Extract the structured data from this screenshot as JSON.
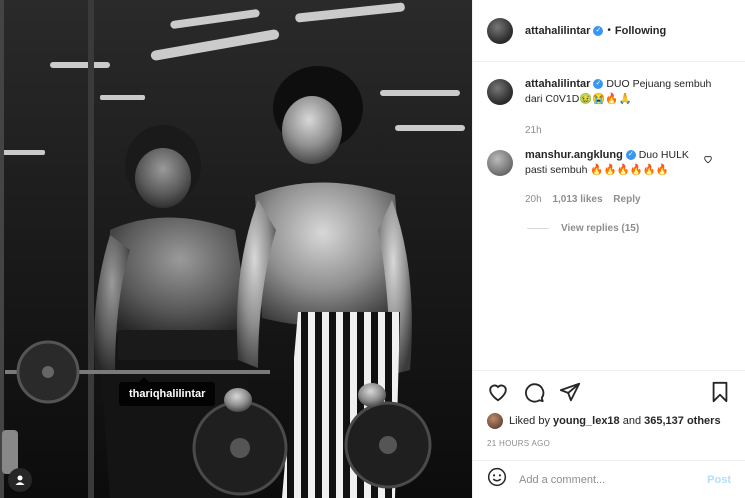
{
  "media": {
    "user_tag": "thariqhalilintar"
  },
  "header": {
    "username": "attahalilintar",
    "separator": "•",
    "follow_status": "Following"
  },
  "caption": {
    "username": "attahalilintar",
    "text": "DUO Pejuang sembuh dari C0V1D🤢😭🔥🙏",
    "time": "21h"
  },
  "comment": {
    "username": "manshur.angklung",
    "text": "Duo HULK pasti sembuh 🔥🔥🔥🔥🔥🔥",
    "time": "20h",
    "likes": "1,013 likes",
    "reply": "Reply",
    "view_replies": "View replies (15)"
  },
  "likes": {
    "prefix": "Liked by ",
    "user": "young_lex18",
    "middle": " and ",
    "count": "365,137 others"
  },
  "post_time": "21 HOURS AGO",
  "add_comment": {
    "placeholder": "Add a comment...",
    "post_label": "Post"
  },
  "icons": {
    "like": "heart-icon",
    "comment": "comment-icon",
    "share": "share-icon",
    "save": "bookmark-icon",
    "emoji": "smiley-icon",
    "verified": "verified-badge-icon"
  }
}
